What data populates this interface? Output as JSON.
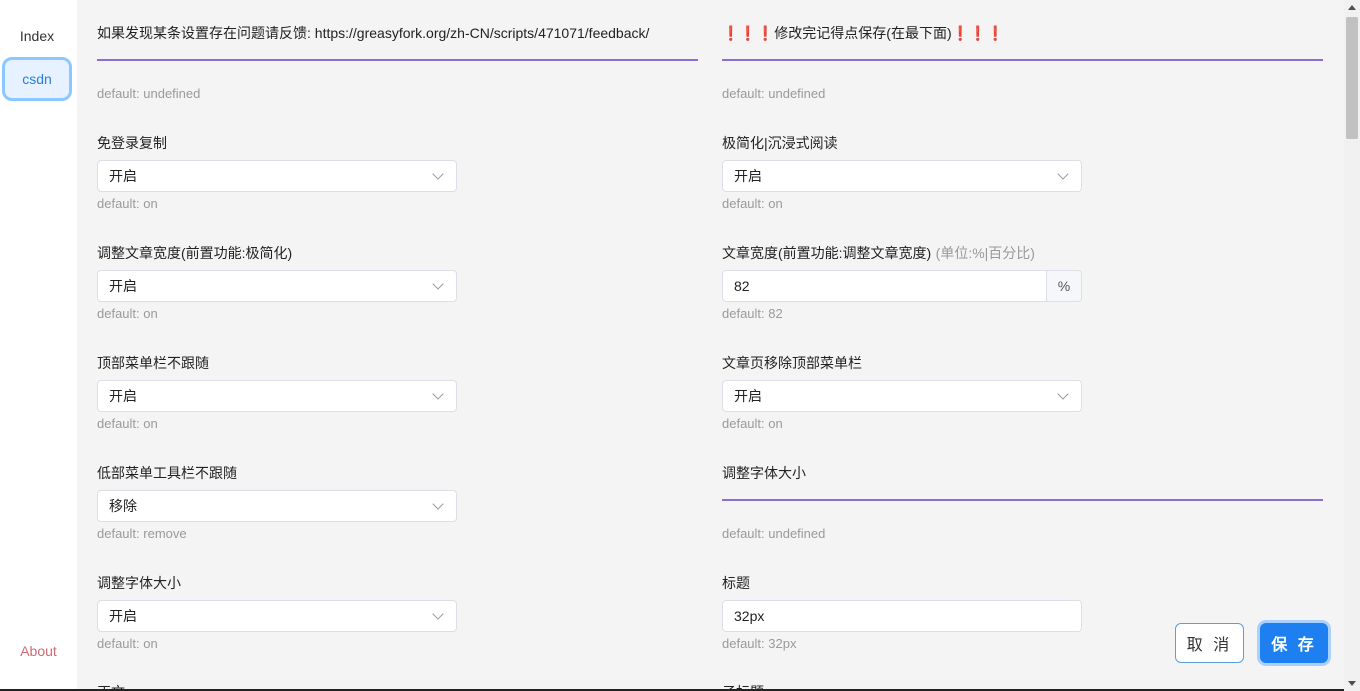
{
  "sidebar": {
    "items": [
      {
        "label": "Index"
      },
      {
        "label": "csdn"
      }
    ],
    "about": "About"
  },
  "left": {
    "feedback_title": "如果发现某条设置存在问题请反馈: https://greasyfork.org/zh-CN/scripts/471071/feedback/",
    "feedback_default": "default: undefined",
    "copy_label": "免登录复制",
    "copy_value": "开启",
    "copy_default": "default: on",
    "width_adjust_label": "调整文章宽度(前置功能:极简化)",
    "width_adjust_value": "开启",
    "width_adjust_default": "default: on",
    "top_menu_label": "顶部菜单栏不跟随",
    "top_menu_value": "开启",
    "top_menu_default": "default: on",
    "bottom_toolbar_label": "低部菜单工具栏不跟随",
    "bottom_toolbar_value": "移除",
    "bottom_toolbar_default": "default: remove",
    "font_size_label": "调整字体大小",
    "font_size_value": "开启",
    "font_size_default": "default: on",
    "body_label": "正文"
  },
  "right": {
    "warning_title": "❗❗❗修改完记得点保存(在最下面)❗❗❗",
    "warning_default": "default: undefined",
    "minimal_label": "极简化|沉浸式阅读",
    "minimal_value": "开启",
    "minimal_default": "default: on",
    "article_width_label": "文章宽度(前置功能:调整文章宽度)",
    "article_width_hint": "(单位:%|百分比)",
    "article_width_value": "82",
    "article_width_unit": "%",
    "article_width_default": "default: 82",
    "remove_top_menu_label": "文章页移除顶部菜单栏",
    "remove_top_menu_value": "开启",
    "remove_top_menu_default": "default: on",
    "font_section_label": "调整字体大小",
    "font_section_default": "default: undefined",
    "heading_label": "标题",
    "heading_value": "32px",
    "heading_default": "default: 32px",
    "subheading_label": "子标题"
  },
  "actions": {
    "cancel": "取 消",
    "save": "保 存"
  },
  "colors": {
    "accent": "#1e7ff0",
    "divider": "#8a6fd1",
    "about": "#d06a73"
  }
}
